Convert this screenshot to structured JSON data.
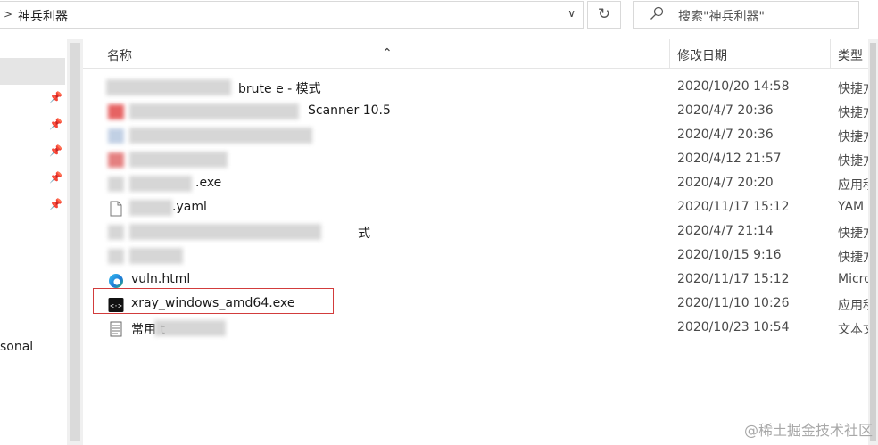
{
  "address": {
    "path": "神兵利器"
  },
  "search": {
    "placeholder": "搜索\"神兵利器\""
  },
  "columns": {
    "name": "名称",
    "modified": "修改日期",
    "type": "类型"
  },
  "nav": {
    "partial_label": "sonal"
  },
  "rows": [
    {
      "name": "brute   e -  模式",
      "modified": "2020/10/20 14:58",
      "type": "快捷方",
      "icon": "shortcut-icon"
    },
    {
      "name": "Scanner 10.5",
      "modified": "2020/4/7 20:36",
      "type": "快捷方",
      "icon": "shortcut-icon"
    },
    {
      "name": "",
      "modified": "2020/4/7 20:36",
      "type": "快捷方",
      "icon": "shortcut-icon"
    },
    {
      "name": "",
      "modified": "2020/4/12 21:57",
      "type": "快捷方",
      "icon": "shortcut-icon"
    },
    {
      "name": ".exe",
      "modified": "2020/4/7 20:20",
      "type": "应用程",
      "icon": "app-icon"
    },
    {
      "name": ".yaml",
      "modified": "2020/11/17 15:12",
      "type": "YAM",
      "icon": "document-icon"
    },
    {
      "name": "式",
      "modified": "2020/4/7 21:14",
      "type": "快捷方",
      "icon": "shortcut-icon"
    },
    {
      "name": "",
      "modified": "2020/10/15 9:16",
      "type": "快捷方",
      "icon": "shortcut-icon"
    },
    {
      "name": "vuln.html",
      "modified": "2020/11/17 15:12",
      "type": "Micro",
      "icon": "edge-icon"
    },
    {
      "name": "xray_windows_amd64.exe",
      "modified": "2020/11/10 10:26",
      "type": "应用程",
      "icon": "exe-icon"
    },
    {
      "name": "常用 t",
      "modified": "2020/10/23 10:54",
      "type": "文本文",
      "icon": "text-file-icon"
    }
  ],
  "watermark": "@稀土掘金技术社区"
}
